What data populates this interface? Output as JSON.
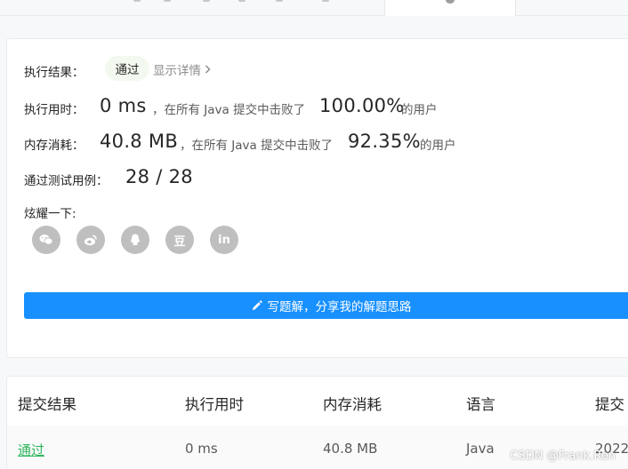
{
  "result": {
    "status_label": "执行结果：",
    "status_value": "通过",
    "details_link": "显示详情",
    "runtime_label": "执行用时：",
    "runtime_value": "0 ms",
    "runtime_beat_prefix": "，在所有 Java 提交中击败了",
    "runtime_percent": "100.00%",
    "runtime_beat_suffix": "的用户",
    "memory_label": "内存消耗：",
    "memory_value": "40.8 MB",
    "memory_beat_prefix": "，在所有 Java 提交中击败了",
    "memory_percent": "92.35%",
    "memory_beat_suffix": "的用户",
    "tests_label": "通过测试用例：",
    "tests_value": "28 / 28",
    "share_label": "炫耀一下:",
    "share_icons": [
      "wechat-icon",
      "weibo-icon",
      "qq-icon",
      "douban-icon",
      "linkedin-icon"
    ],
    "douban_glyph": "豆",
    "linkedin_glyph": "in",
    "write_button": "写题解，分享我的解题思路"
  },
  "submissions": {
    "headers": [
      "提交结果",
      "执行用时",
      "内存消耗",
      "语言",
      "提交"
    ],
    "rows": [
      {
        "status": "通过",
        "runtime": "0 ms",
        "memory": "40.8 MB",
        "language": "Java",
        "time": "2022"
      }
    ]
  },
  "watermark": "CSDN @Frank.Ren",
  "colors": {
    "accent": "#1890ff",
    "pass_green": "#2db55d",
    "pill_bg": "#f3f9ee",
    "icon_gray": "#bfbfbf"
  }
}
